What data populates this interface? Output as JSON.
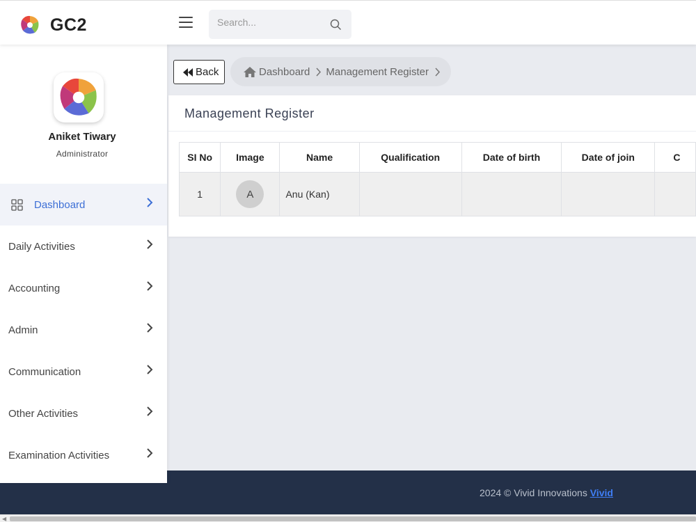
{
  "brand": {
    "name": "GC2",
    "logo_icon": "pinwheel-logo-icon"
  },
  "search": {
    "placeholder": "Search..."
  },
  "profile": {
    "name": "Aniket Tiwary",
    "role": "Administrator"
  },
  "sidebar": {
    "items": [
      {
        "label": "Dashboard",
        "active": true
      },
      {
        "label": "Daily Activities"
      },
      {
        "label": "Accounting"
      },
      {
        "label": "Admin"
      },
      {
        "label": "Communication"
      },
      {
        "label": "Other Activities"
      },
      {
        "label": "Examination Activities"
      }
    ]
  },
  "toolbar": {
    "back_label": "Back"
  },
  "breadcrumb": {
    "items": [
      "Dashboard",
      "Management Register"
    ]
  },
  "card": {
    "title": "Management Register",
    "table": {
      "headers": [
        "SI No",
        "Image",
        "Name",
        "Qualification",
        "Date of birth",
        "Date of join",
        "C"
      ],
      "rows": [
        {
          "sl": "1",
          "avatar": "A",
          "name": "Anu (Kan)",
          "qualification": "",
          "dob": "",
          "doj": "",
          "more": ""
        }
      ]
    }
  },
  "footer": {
    "text": "2024 © Vivid Innovations ",
    "link": "Vivid"
  },
  "colors": {
    "accent": "#3d6fd6",
    "footer_bg": "#233048",
    "footer_link": "#3f7ef5"
  }
}
